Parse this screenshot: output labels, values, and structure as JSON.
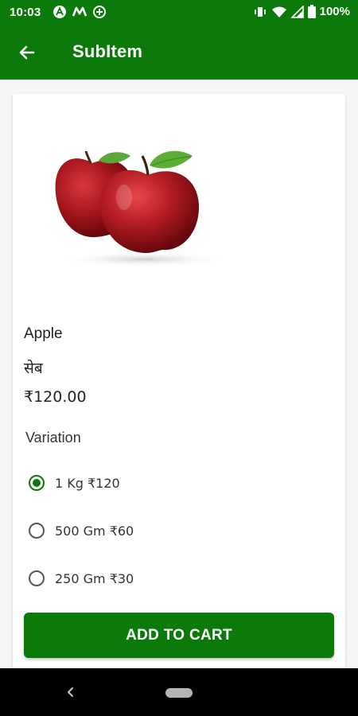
{
  "status_bar": {
    "time": "10:03",
    "battery": "100%",
    "left_icons": [
      "a-notification-icon",
      "m-notification-icon",
      "data-saver-icon"
    ],
    "right_icons": [
      "vibrate-icon",
      "wifi-icon",
      "signal-icon",
      "battery-icon"
    ]
  },
  "app_bar": {
    "title": "SubItem",
    "back_icon": "arrow-back-icon",
    "color": "#0b7a0b"
  },
  "product": {
    "image": "apple-image",
    "name": "Apple",
    "name_local": "सेब",
    "price": "₹120.00"
  },
  "variation": {
    "label": "Variation",
    "options": [
      {
        "label": "1 Kg ₹120",
        "selected": true
      },
      {
        "label": "500 Gm ₹60",
        "selected": false
      },
      {
        "label": "250 Gm ₹30",
        "selected": false
      }
    ]
  },
  "cart": {
    "button_label": "ADD TO CART"
  },
  "nav_bar": {
    "back_icon": "nav-back-icon",
    "home_icon": "nav-home-pill-icon"
  }
}
